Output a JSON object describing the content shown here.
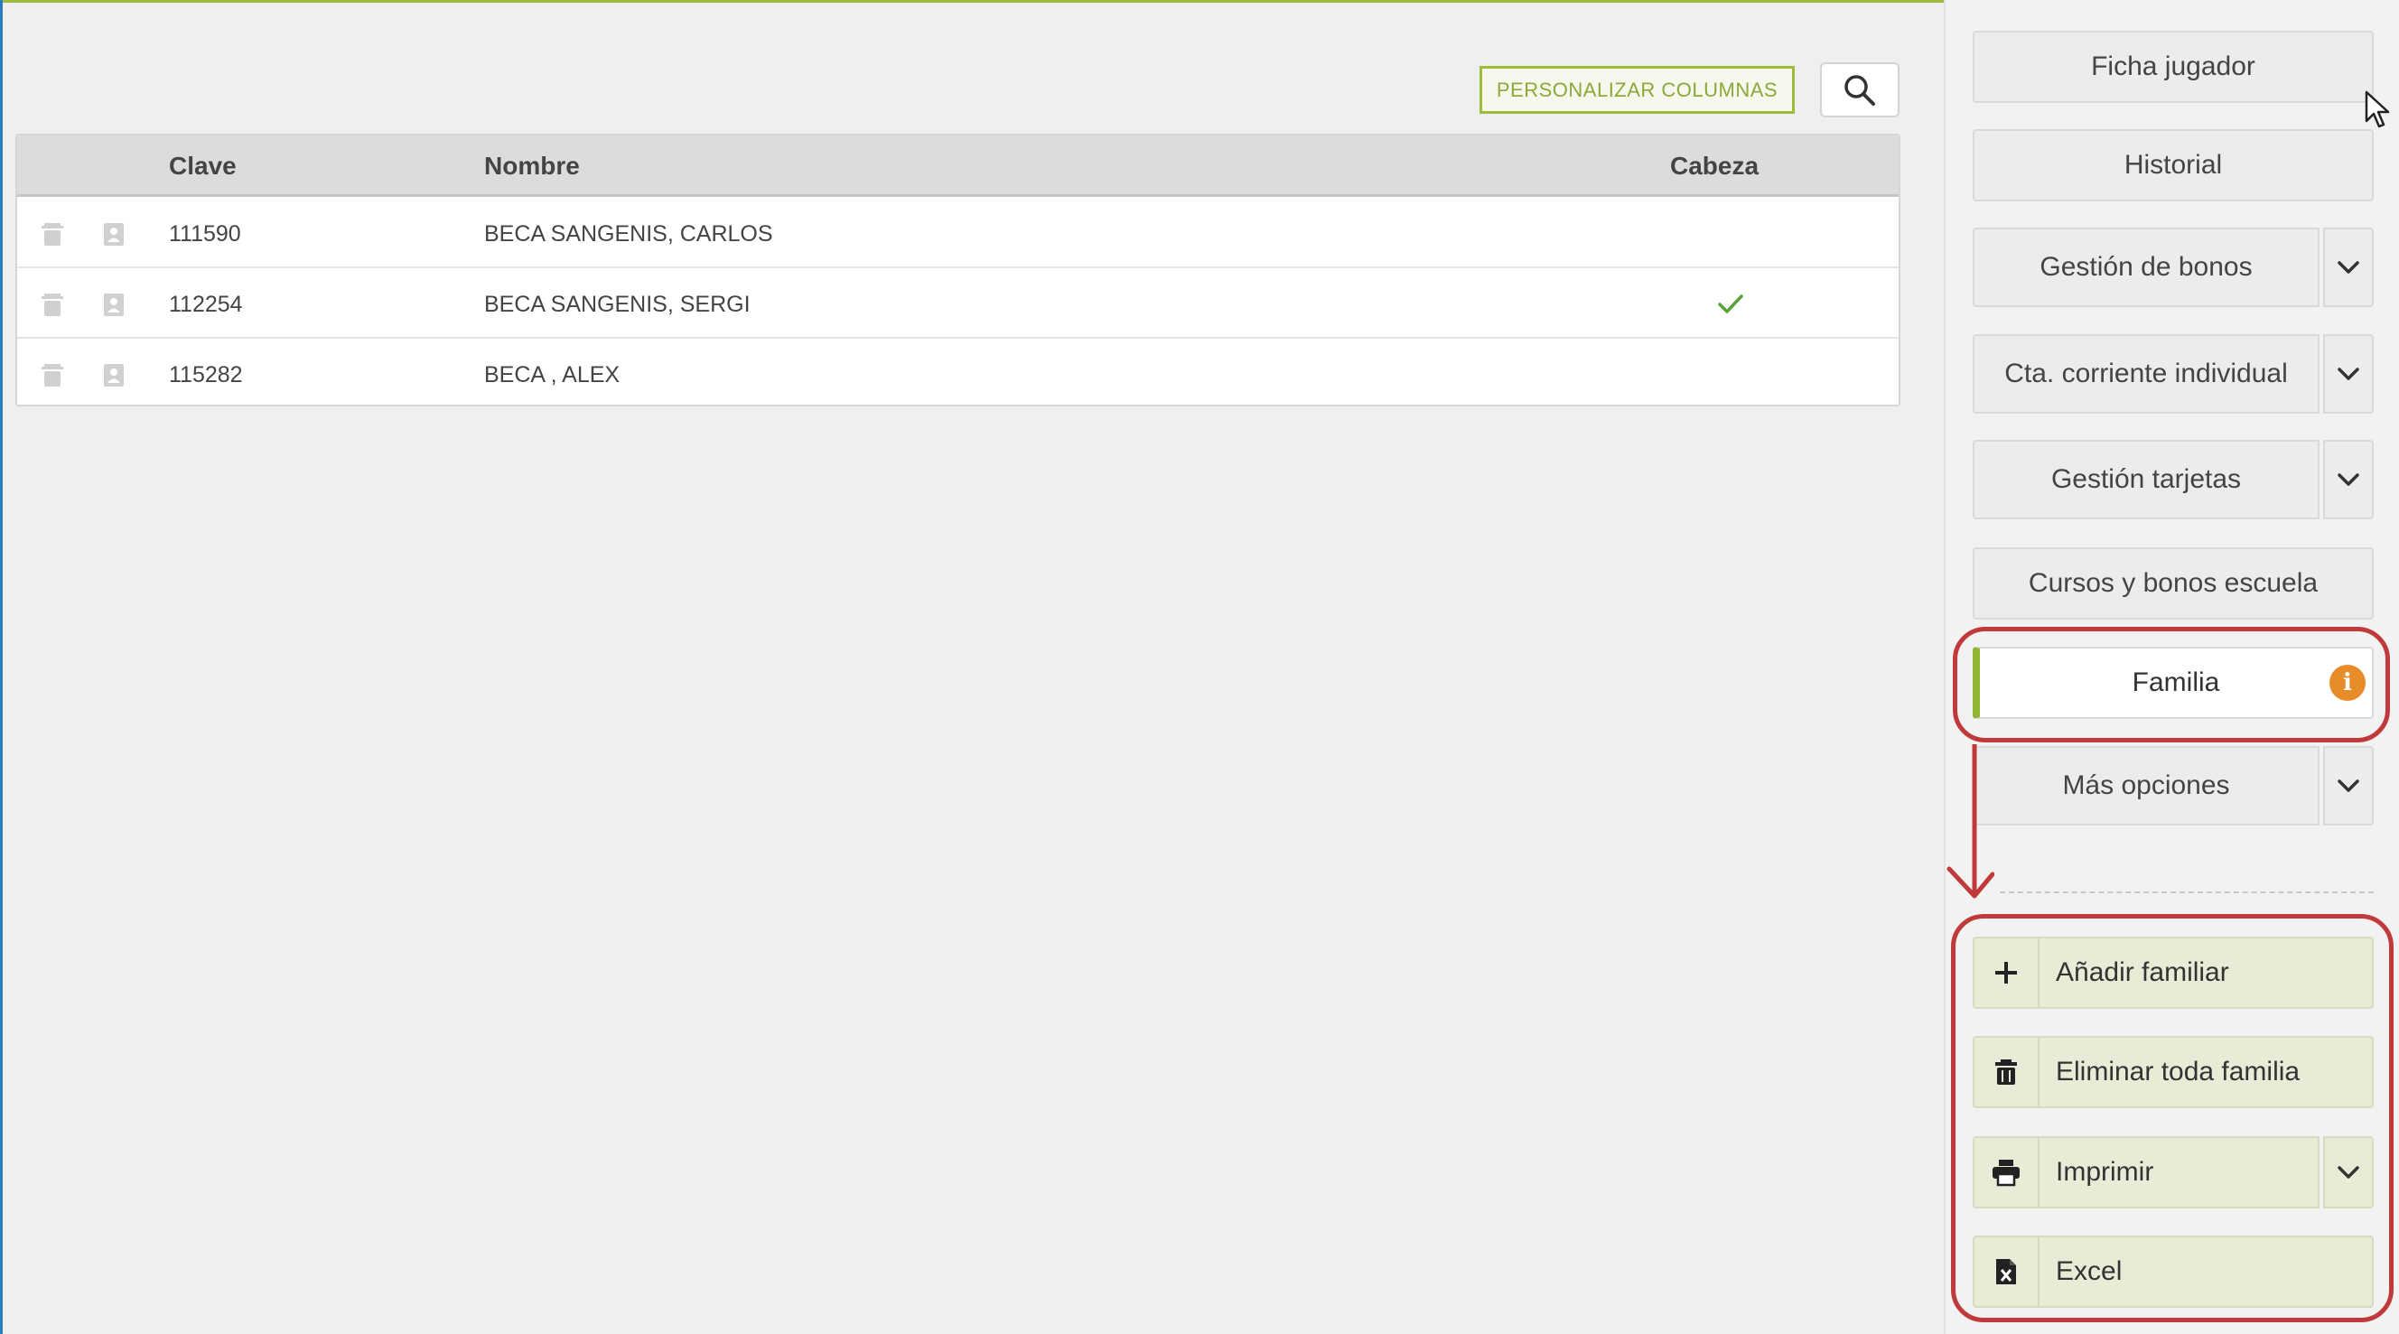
{
  "colors": {
    "accent_green": "#9cbd3b",
    "info_orange": "#e88c2a",
    "annotation_red": "#c0393b",
    "check_green": "#5aa13a"
  },
  "toolbar": {
    "personalize_label": "PERSONALIZAR COLUMNAS",
    "search_icon": "search-icon"
  },
  "table": {
    "headers": {
      "clave": "Clave",
      "nombre": "Nombre",
      "cabeza": "Cabeza"
    },
    "rows": [
      {
        "clave": "111590",
        "nombre": "BECA SANGENIS, CARLOS",
        "cabeza": false
      },
      {
        "clave": "112254",
        "nombre": "BECA SANGENIS, SERGI",
        "cabeza": true
      },
      {
        "clave": "115282",
        "nombre": "BECA , ALEX",
        "cabeza": false
      }
    ],
    "row_icons": [
      "trash-icon",
      "contact-card-icon"
    ]
  },
  "sidebar": {
    "ficha": "Ficha jugador",
    "historial": "Historial",
    "bonos": "Gestión de bonos",
    "cta": "Cta. corriente individual",
    "tarjetas": "Gestión tarjetas",
    "cursos": "Cursos y bonos escuela",
    "familia": "Familia",
    "familia_info": "i",
    "mas": "Más opciones"
  },
  "actions": {
    "anadir": "Añadir familiar",
    "eliminar": "Eliminar toda familia",
    "imprimir": "Imprimir",
    "excel": "Excel"
  }
}
